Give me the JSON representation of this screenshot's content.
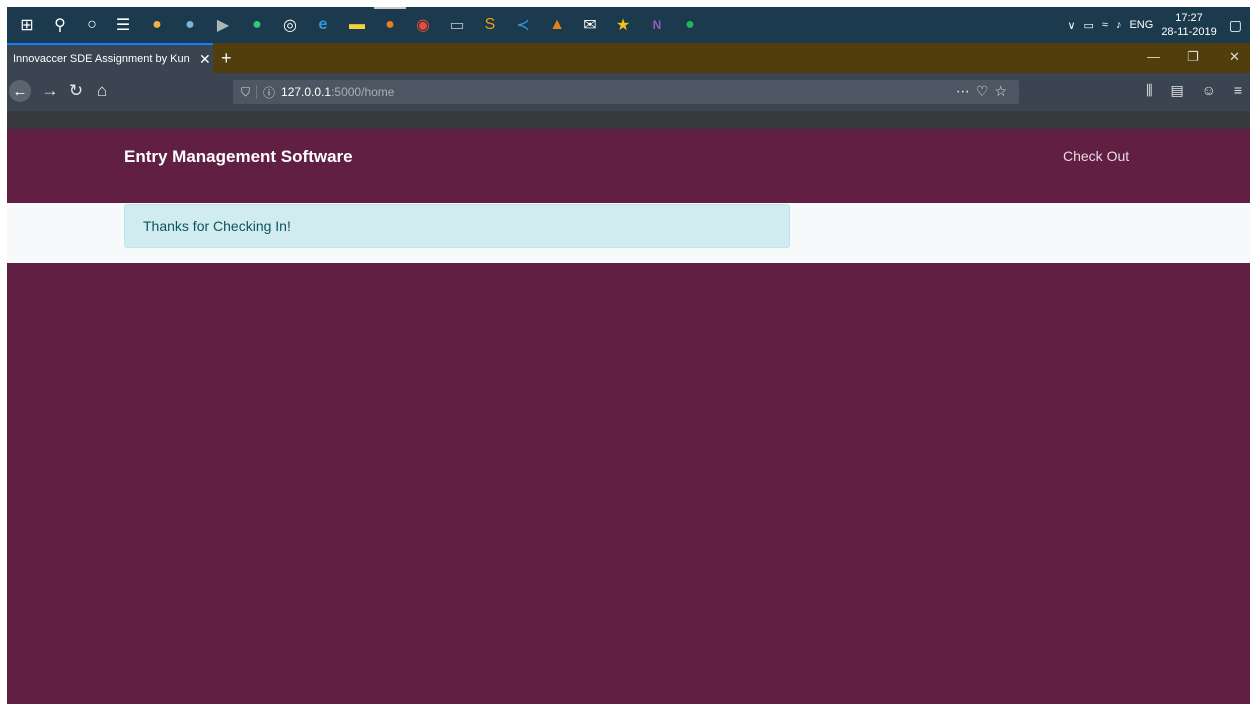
{
  "taskbar": {
    "icons": [
      "windows-start-icon",
      "search-icon",
      "cortana-icon",
      "task-view-icon",
      "photos-icon",
      "browser-icon",
      "media-player-icon",
      "whatsapp-icon",
      "settings-icon",
      "edge-icon",
      "file-explorer-icon",
      "firefox-icon",
      "chrome-icon",
      "terminal-icon",
      "sublime-icon",
      "vscode-icon",
      "vlc-icon",
      "mail-icon",
      "star-app-icon",
      "onenote-icon",
      "spotify-icon"
    ],
    "language": "ENG",
    "time": "17:27",
    "date": "28-11-2019"
  },
  "browser": {
    "tab_title": "Innovaccer SDE Assignment by Kun",
    "url_host": "127.0.0.1",
    "url_path": ":5000/home"
  },
  "app": {
    "brand": "Entry Management Software",
    "nav_checkout": "Check Out",
    "alert_message": "Thanks for Checking In!"
  },
  "colors": {
    "primary": "#611f43",
    "alert_bg": "#d1ecf1",
    "alert_text": "#0c5460"
  }
}
